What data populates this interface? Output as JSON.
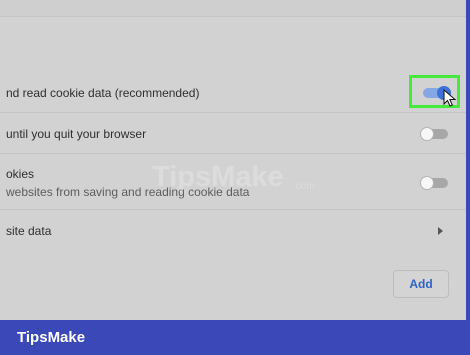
{
  "settings_rows": [
    {
      "title": "nd read cookie data (recommended)",
      "toggle": "on"
    },
    {
      "title": "until you quit your browser",
      "toggle": "off"
    },
    {
      "title": "okies",
      "subtitle": "websites from saving and reading cookie data",
      "toggle": "off"
    },
    {
      "title": "site data"
    }
  ],
  "button": {
    "add_label": "Add"
  },
  "branding": {
    "watermark_text": "TipsMake",
    "watermark_suffix": ".com",
    "footer_brand": "TipsMake"
  },
  "colors": {
    "frame_blue": "#3b48b8",
    "panel_gray": "#d2d2d2",
    "highlight_green": "#45ea3c",
    "toggle_on_blue": "#3d73d7",
    "link_blue": "#2f63c6"
  },
  "icons": {
    "cursor": "cursor-icon",
    "arrow_right": "chevron-right-icon"
  }
}
